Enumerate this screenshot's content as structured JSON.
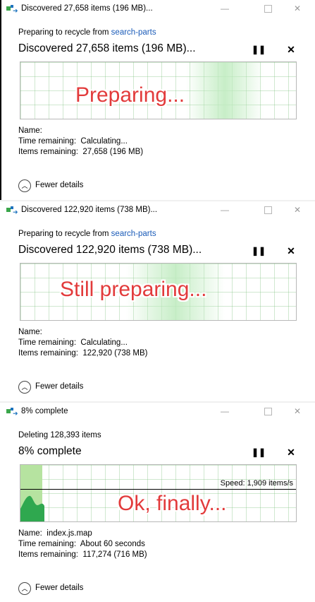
{
  "dialogs": [
    {
      "title": "Discovered 27,658 items (196 MB)...",
      "subtitle_prefix": "Preparing to recycle from ",
      "subtitle_link": "search-parts",
      "status": "Discovered 27,658 items (196 MB)...",
      "overlay": "Preparing...",
      "name_label": "Name:",
      "name_value": "",
      "time_label": "Time remaining:",
      "time_value": "Calculating...",
      "items_label": "Items remaining:",
      "items_value": "27,658 (196 MB)",
      "fewer_details": "Fewer details"
    },
    {
      "title": "Discovered 122,920 items (738 MB)...",
      "subtitle_prefix": "Preparing to recycle from ",
      "subtitle_link": "search-parts",
      "status": "Discovered 122,920 items (738 MB)...",
      "overlay": "Still preparing...",
      "name_label": "Name:",
      "name_value": "",
      "time_label": "Time remaining:",
      "time_value": "Calculating...",
      "items_label": "Items remaining:",
      "items_value": "122,920 (738 MB)",
      "fewer_details": "Fewer details"
    },
    {
      "title": "8% complete",
      "subtitle_prefix": "Deleting 128,393 items",
      "subtitle_link": "",
      "status": "8% complete",
      "overlay": "Ok, finally...",
      "speed": "Speed: 1,909 items/s",
      "progress_fraction": 0.08,
      "name_label": "Name:",
      "name_value": "index.js.map",
      "time_label": "Time remaining:",
      "time_value": "About 60 seconds",
      "items_label": "Items remaining:",
      "items_value": "117,274 (716 MB)",
      "fewer_details": "Fewer details"
    }
  ],
  "controls": {
    "minimize_glyph": "—",
    "close_glyph": "✕",
    "pause_glyph": "❚❚",
    "cancel_glyph": "✕",
    "fewer_glyph": "︿"
  },
  "colors": {
    "link": "#1a5bb8",
    "overlay_text": "#e23b3b",
    "graph_fill": "#b6e3a0",
    "graph_line": "#2fa84f"
  }
}
